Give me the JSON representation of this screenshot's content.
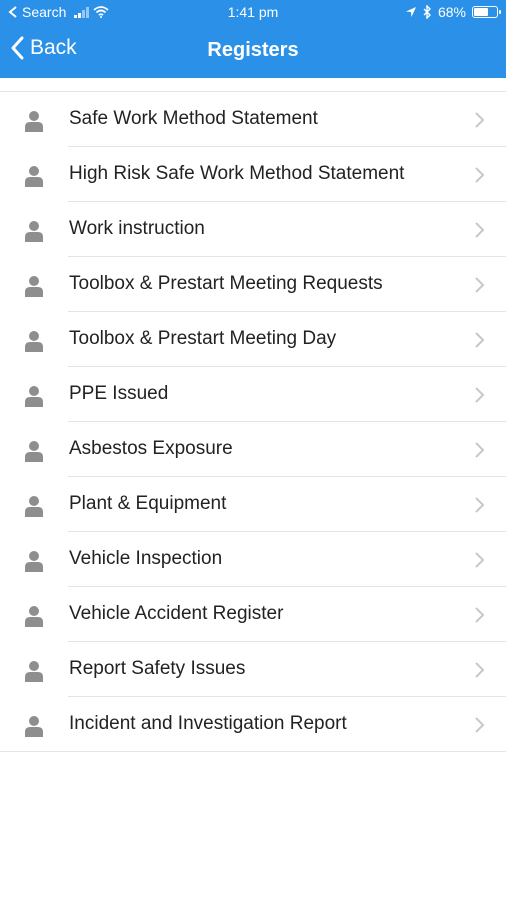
{
  "status_bar": {
    "carrier": "Search",
    "time": "1:41 pm",
    "battery_percent": "68%",
    "battery_level": 0.68
  },
  "nav": {
    "back_label": "Back",
    "title": "Registers"
  },
  "colors": {
    "header": "#2b91e8",
    "icon": "#8e8e8e",
    "chevron": "#c7c7cc"
  },
  "icons": {
    "row_icon": "person-icon",
    "row_chevron": "chevron-right-icon"
  },
  "items": [
    {
      "label": "Safe Work Method Statement"
    },
    {
      "label": "High Risk Safe Work Method Statement"
    },
    {
      "label": "Work instruction"
    },
    {
      "label": "Toolbox & Prestart Meeting Requests"
    },
    {
      "label": "Toolbox & Prestart Meeting Day"
    },
    {
      "label": "PPE Issued"
    },
    {
      "label": "Asbestos Exposure"
    },
    {
      "label": "Plant & Equipment"
    },
    {
      "label": "Vehicle Inspection"
    },
    {
      "label": "Vehicle Accident Register"
    },
    {
      "label": "Report Safety Issues"
    },
    {
      "label": "Incident and Investigation Report"
    }
  ]
}
